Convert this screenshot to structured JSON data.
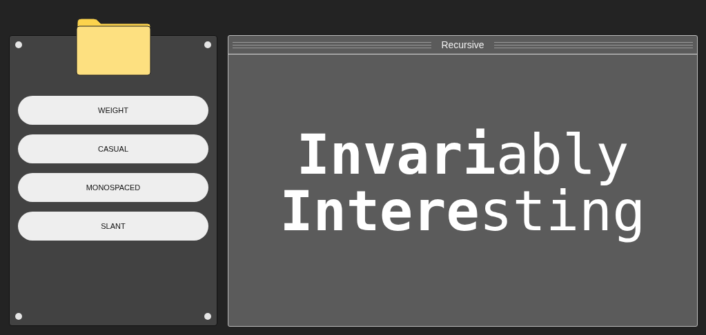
{
  "sidebar": {
    "buttons": [
      "WEIGHT",
      "CASUAL",
      "MONOSPACED",
      "SLANT"
    ]
  },
  "preview": {
    "title": "Recursive",
    "lines": [
      [
        {
          "text": "Invar",
          "kind": "heavy"
        },
        {
          "text": "i",
          "kind": "bold"
        },
        {
          "text": "ably",
          "kind": "light"
        }
      ],
      [
        {
          "text": "Inter",
          "kind": "heavy"
        },
        {
          "text": "e",
          "kind": "bold"
        },
        {
          "text": "sting",
          "kind": "light"
        }
      ]
    ]
  }
}
